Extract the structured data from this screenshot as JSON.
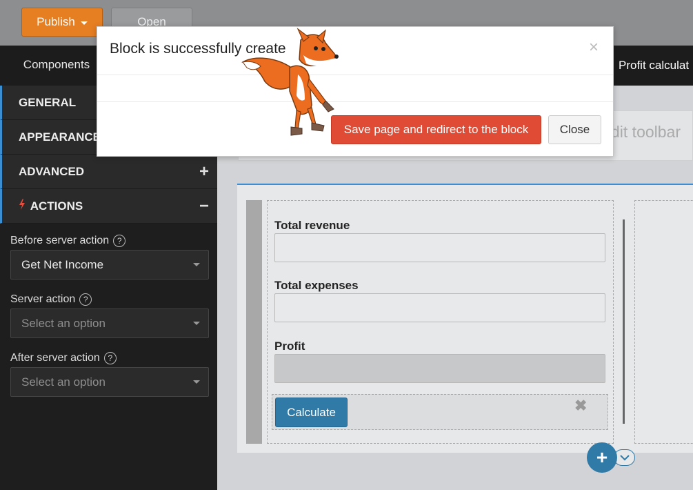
{
  "toolbar": {
    "publish_label": "Publish",
    "open_label": "Open"
  },
  "tabs": {
    "components_label": "Components",
    "profit_label": "Profit calculat"
  },
  "sidebar": {
    "sections": [
      {
        "label": "GENERAL",
        "toggle": ""
      },
      {
        "label": "APPEARANCE",
        "toggle": ""
      },
      {
        "label": "ADVANCED",
        "toggle": "+"
      },
      {
        "label": "ACTIONS",
        "toggle": "−"
      }
    ],
    "actions": {
      "before_label": "Before server action",
      "before_value": "Get Net Income",
      "server_label": "Server action",
      "server_placeholder": "Select an option",
      "after_label": "After server action",
      "after_placeholder": "Select an option",
      "help_glyph": "?"
    }
  },
  "canvas": {
    "edit_toolbar_text": "dit toolbar",
    "fields": [
      {
        "label": "Total revenue"
      },
      {
        "label": "Total expenses"
      },
      {
        "label": "Profit"
      }
    ],
    "calculate_label": "Calculate",
    "remove_glyph": "✖",
    "add_glyph": "+"
  },
  "modal": {
    "title": "Block is successfully create",
    "close_glyph": "×",
    "save_label": "Save page and redirect to the block",
    "close_label": "Close"
  },
  "colors": {
    "publish": "#e67e22",
    "accent": "#3a8ed1",
    "danger": "#e04b35",
    "primary": "#2f7aa7",
    "fox_orange": "#ec6d1f"
  },
  "icons": {
    "caret": "caret-down-icon",
    "bolt": "lightning-bolt-icon",
    "help": "help-circle-icon",
    "mascot": "fox-mascot"
  }
}
